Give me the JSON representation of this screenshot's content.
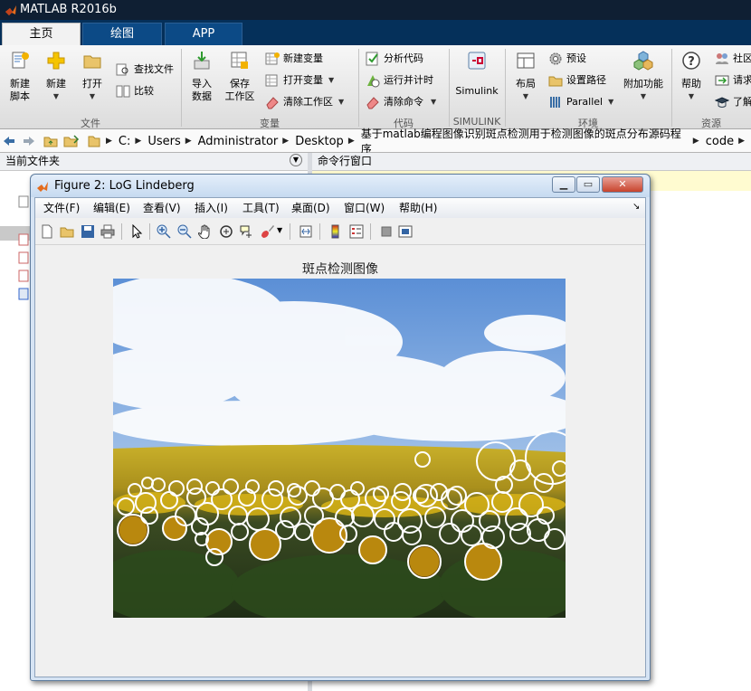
{
  "app": {
    "title": "MATLAB R2016b"
  },
  "tabs": [
    {
      "label": "主页"
    },
    {
      "label": "绘图"
    },
    {
      "label": "APP"
    }
  ],
  "ribbon": {
    "groups": [
      {
        "label": "文件"
      },
      {
        "label": "变量"
      },
      {
        "label": "代码"
      },
      {
        "label": "SIMULINK"
      },
      {
        "label": "环境"
      },
      {
        "label": "资源"
      }
    ],
    "new_script": {
      "line1": "新建",
      "line2": "脚本"
    },
    "new": {
      "label": "新建"
    },
    "open": {
      "label": "打开"
    },
    "find_files": {
      "label": "查找文件"
    },
    "compare": {
      "label": "比较"
    },
    "import": {
      "line1": "导入",
      "line2": "数据"
    },
    "save_ws": {
      "line1": "保存",
      "line2": "工作区"
    },
    "new_var": {
      "label": "新建变量"
    },
    "open_var": {
      "label": "打开变量"
    },
    "clear_ws": {
      "label": "清除工作区"
    },
    "analyze_code": {
      "label": "分析代码"
    },
    "run_time": {
      "label": "运行并计时"
    },
    "clear_cmd": {
      "label": "清除命令"
    },
    "simulink": {
      "label": "Simulink"
    },
    "layout": {
      "label": "布局"
    },
    "preferences": {
      "label": "预设"
    },
    "set_path": {
      "label": "设置路径"
    },
    "parallel": {
      "label": "Parallel"
    },
    "addons": {
      "label": "附加功能"
    },
    "help": {
      "label": "帮助"
    },
    "community": {
      "label": "社区"
    },
    "request": {
      "label": "请求"
    },
    "learn": {
      "label": "了解"
    }
  },
  "address": {
    "crumbs": [
      "C:",
      "Users",
      "Administrator",
      "Desktop",
      "基于matlab编程图像识别斑点检测用于检测图像的斑点分布源码程序",
      "code"
    ]
  },
  "panels": {
    "current_folder": "当前文件夹",
    "command_window": "命令行窗口"
  },
  "figure": {
    "title": "Figure 2: LoG Lindeberg",
    "menus": [
      "文件(F)",
      "编辑(E)",
      "查看(V)",
      "插入(I)",
      "工具(T)",
      "桌面(D)",
      "窗口(W)",
      "帮助(H)"
    ],
    "plot_title": "斑点检测图像"
  },
  "colors": {
    "matlab_dark": "#0f1f33",
    "tab_blue": "#0c4a86",
    "circle": "#ffffff"
  }
}
